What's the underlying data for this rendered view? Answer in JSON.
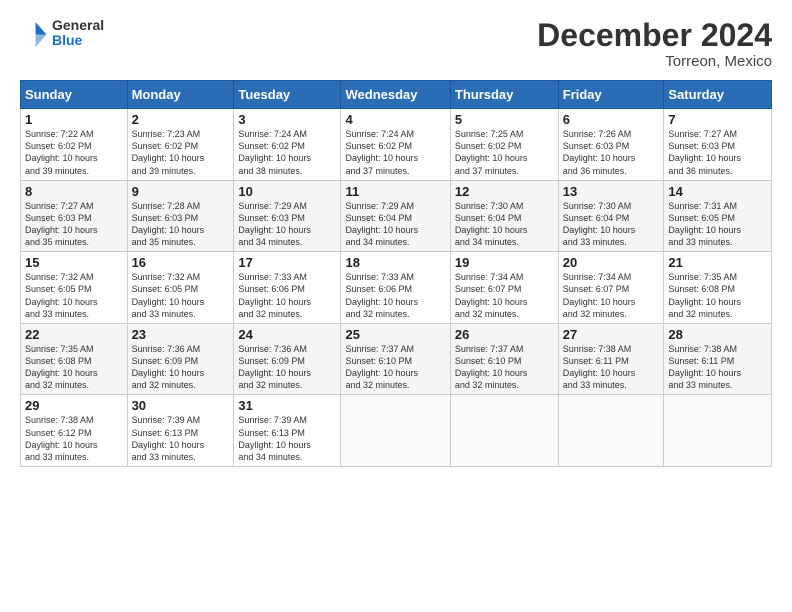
{
  "header": {
    "logo_general": "General",
    "logo_blue": "Blue",
    "month_title": "December 2024",
    "location": "Torreon, Mexico"
  },
  "days_of_week": [
    "Sunday",
    "Monday",
    "Tuesday",
    "Wednesday",
    "Thursday",
    "Friday",
    "Saturday"
  ],
  "weeks": [
    [
      {
        "day": "1",
        "info": "Sunrise: 7:22 AM\nSunset: 6:02 PM\nDaylight: 10 hours\nand 39 minutes."
      },
      {
        "day": "2",
        "info": "Sunrise: 7:23 AM\nSunset: 6:02 PM\nDaylight: 10 hours\nand 39 minutes."
      },
      {
        "day": "3",
        "info": "Sunrise: 7:24 AM\nSunset: 6:02 PM\nDaylight: 10 hours\nand 38 minutes."
      },
      {
        "day": "4",
        "info": "Sunrise: 7:24 AM\nSunset: 6:02 PM\nDaylight: 10 hours\nand 37 minutes."
      },
      {
        "day": "5",
        "info": "Sunrise: 7:25 AM\nSunset: 6:02 PM\nDaylight: 10 hours\nand 37 minutes."
      },
      {
        "day": "6",
        "info": "Sunrise: 7:26 AM\nSunset: 6:03 PM\nDaylight: 10 hours\nand 36 minutes."
      },
      {
        "day": "7",
        "info": "Sunrise: 7:27 AM\nSunset: 6:03 PM\nDaylight: 10 hours\nand 36 minutes."
      }
    ],
    [
      {
        "day": "8",
        "info": "Sunrise: 7:27 AM\nSunset: 6:03 PM\nDaylight: 10 hours\nand 35 minutes."
      },
      {
        "day": "9",
        "info": "Sunrise: 7:28 AM\nSunset: 6:03 PM\nDaylight: 10 hours\nand 35 minutes."
      },
      {
        "day": "10",
        "info": "Sunrise: 7:29 AM\nSunset: 6:03 PM\nDaylight: 10 hours\nand 34 minutes."
      },
      {
        "day": "11",
        "info": "Sunrise: 7:29 AM\nSunset: 6:04 PM\nDaylight: 10 hours\nand 34 minutes."
      },
      {
        "day": "12",
        "info": "Sunrise: 7:30 AM\nSunset: 6:04 PM\nDaylight: 10 hours\nand 34 minutes."
      },
      {
        "day": "13",
        "info": "Sunrise: 7:30 AM\nSunset: 6:04 PM\nDaylight: 10 hours\nand 33 minutes."
      },
      {
        "day": "14",
        "info": "Sunrise: 7:31 AM\nSunset: 6:05 PM\nDaylight: 10 hours\nand 33 minutes."
      }
    ],
    [
      {
        "day": "15",
        "info": "Sunrise: 7:32 AM\nSunset: 6:05 PM\nDaylight: 10 hours\nand 33 minutes."
      },
      {
        "day": "16",
        "info": "Sunrise: 7:32 AM\nSunset: 6:05 PM\nDaylight: 10 hours\nand 33 minutes."
      },
      {
        "day": "17",
        "info": "Sunrise: 7:33 AM\nSunset: 6:06 PM\nDaylight: 10 hours\nand 32 minutes."
      },
      {
        "day": "18",
        "info": "Sunrise: 7:33 AM\nSunset: 6:06 PM\nDaylight: 10 hours\nand 32 minutes."
      },
      {
        "day": "19",
        "info": "Sunrise: 7:34 AM\nSunset: 6:07 PM\nDaylight: 10 hours\nand 32 minutes."
      },
      {
        "day": "20",
        "info": "Sunrise: 7:34 AM\nSunset: 6:07 PM\nDaylight: 10 hours\nand 32 minutes."
      },
      {
        "day": "21",
        "info": "Sunrise: 7:35 AM\nSunset: 6:08 PM\nDaylight: 10 hours\nand 32 minutes."
      }
    ],
    [
      {
        "day": "22",
        "info": "Sunrise: 7:35 AM\nSunset: 6:08 PM\nDaylight: 10 hours\nand 32 minutes."
      },
      {
        "day": "23",
        "info": "Sunrise: 7:36 AM\nSunset: 6:09 PM\nDaylight: 10 hours\nand 32 minutes."
      },
      {
        "day": "24",
        "info": "Sunrise: 7:36 AM\nSunset: 6:09 PM\nDaylight: 10 hours\nand 32 minutes."
      },
      {
        "day": "25",
        "info": "Sunrise: 7:37 AM\nSunset: 6:10 PM\nDaylight: 10 hours\nand 32 minutes."
      },
      {
        "day": "26",
        "info": "Sunrise: 7:37 AM\nSunset: 6:10 PM\nDaylight: 10 hours\nand 32 minutes."
      },
      {
        "day": "27",
        "info": "Sunrise: 7:38 AM\nSunset: 6:11 PM\nDaylight: 10 hours\nand 33 minutes."
      },
      {
        "day": "28",
        "info": "Sunrise: 7:38 AM\nSunset: 6:11 PM\nDaylight: 10 hours\nand 33 minutes."
      }
    ],
    [
      {
        "day": "29",
        "info": "Sunrise: 7:38 AM\nSunset: 6:12 PM\nDaylight: 10 hours\nand 33 minutes."
      },
      {
        "day": "30",
        "info": "Sunrise: 7:39 AM\nSunset: 6:13 PM\nDaylight: 10 hours\nand 33 minutes."
      },
      {
        "day": "31",
        "info": "Sunrise: 7:39 AM\nSunset: 6:13 PM\nDaylight: 10 hours\nand 34 minutes."
      },
      {
        "day": "",
        "info": ""
      },
      {
        "day": "",
        "info": ""
      },
      {
        "day": "",
        "info": ""
      },
      {
        "day": "",
        "info": ""
      }
    ]
  ]
}
